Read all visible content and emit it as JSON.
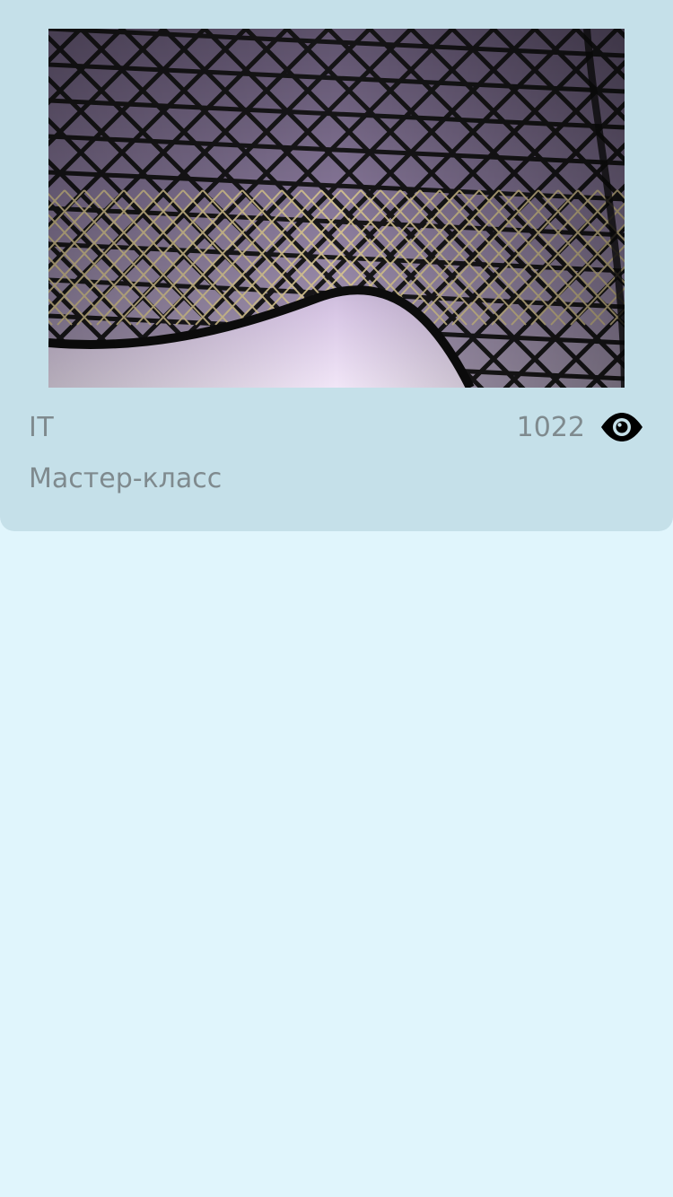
{
  "card": {
    "image_name": "glass-canopy-architecture-photo",
    "category": "IT",
    "views": "1022",
    "views_icon": "eye-icon",
    "event_type": "Мастер-класс"
  },
  "colors": {
    "page_background": "#e0f5fc",
    "card_background": "#c5e0e9",
    "text_muted": "#7f8a8e",
    "icon": "#000000"
  }
}
